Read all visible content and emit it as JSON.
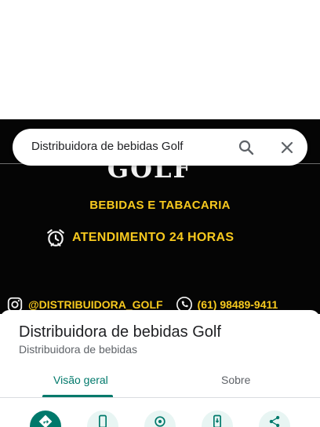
{
  "search": {
    "query": "Distribuidora de bebidas Golf"
  },
  "hero": {
    "logo_text": "GOLF",
    "subtitle": "BEBIDAS E TABACARIA",
    "hours": "ATENDIMENTO 24 HORAS",
    "instagram": "@DISTRIBUIDORA_GOLF",
    "phone": "(61) 98489-9411"
  },
  "place": {
    "name": "Distribuidora de bebidas Golf",
    "category": "Distribuidora de bebidas"
  },
  "tabs": [
    {
      "label": "Visão geral",
      "active": true
    },
    {
      "label": "Sobre",
      "active": false
    }
  ],
  "colors": {
    "accent": "#00796b",
    "hero_text": "#f7c91e",
    "hero_background": "#050505"
  },
  "actions": [
    {
      "icon": "directions-icon"
    },
    {
      "icon": "phone-icon"
    },
    {
      "icon": "save-place-icon"
    },
    {
      "icon": "send-to-phone-icon"
    },
    {
      "icon": "share-icon"
    }
  ]
}
